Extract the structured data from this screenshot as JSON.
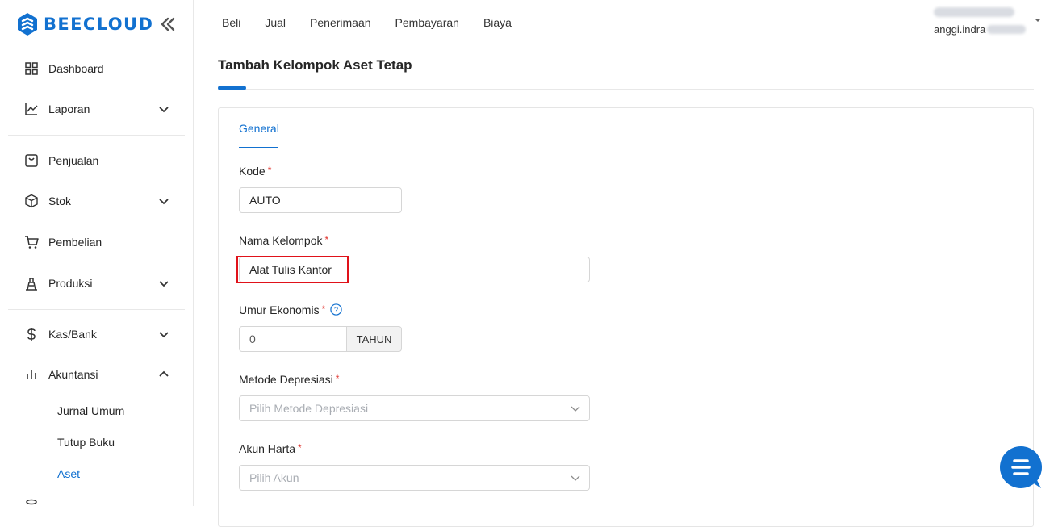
{
  "brand": {
    "name": "BEECLOUD",
    "color": "#1271d0"
  },
  "sidebar": {
    "items": [
      {
        "label": "Dashboard",
        "icon": "dashboard-icon"
      },
      {
        "label": "Laporan",
        "icon": "chart-line-icon",
        "expandable": true
      },
      {
        "label": "Penjualan",
        "icon": "sales-icon"
      },
      {
        "label": "Stok",
        "icon": "box-icon",
        "expandable": true
      },
      {
        "label": "Pembelian",
        "icon": "cart-icon"
      },
      {
        "label": "Produksi",
        "icon": "production-icon",
        "expandable": true
      },
      {
        "label": "Kas/Bank",
        "icon": "dollar-icon",
        "expandable": true
      },
      {
        "label": "Akuntansi",
        "icon": "bar-chart-icon",
        "expandable": true,
        "expanded": true
      }
    ],
    "subitems": [
      {
        "label": "Jurnal Umum"
      },
      {
        "label": "Tutup Buku"
      },
      {
        "label": "Aset",
        "active": true
      }
    ]
  },
  "topmenu": [
    "Beli",
    "Jual",
    "Penerimaan",
    "Pembayaran",
    "Biaya"
  ],
  "user": {
    "email_visible": "anggi.indra"
  },
  "page": {
    "title": "Tambah Kelompok Aset Tetap"
  },
  "tabs": [
    {
      "label": "General",
      "active": true
    }
  ],
  "form": {
    "kode": {
      "label": "Kode",
      "value": "AUTO"
    },
    "nama_kelompok": {
      "label": "Nama Kelompok",
      "value": "Alat Tulis Kantor"
    },
    "umur_ekonomis": {
      "label": "Umur Ekonomis",
      "value": "0",
      "unit": "TAHUN"
    },
    "metode_depresiasi": {
      "label": "Metode Depresiasi",
      "placeholder": "Pilih Metode Depresiasi"
    },
    "akun_harta": {
      "label": "Akun Harta",
      "placeholder": "Pilih Akun"
    }
  },
  "colors": {
    "accent": "#1271d0",
    "required": "#e0312b",
    "highlight": "#e0121a"
  }
}
